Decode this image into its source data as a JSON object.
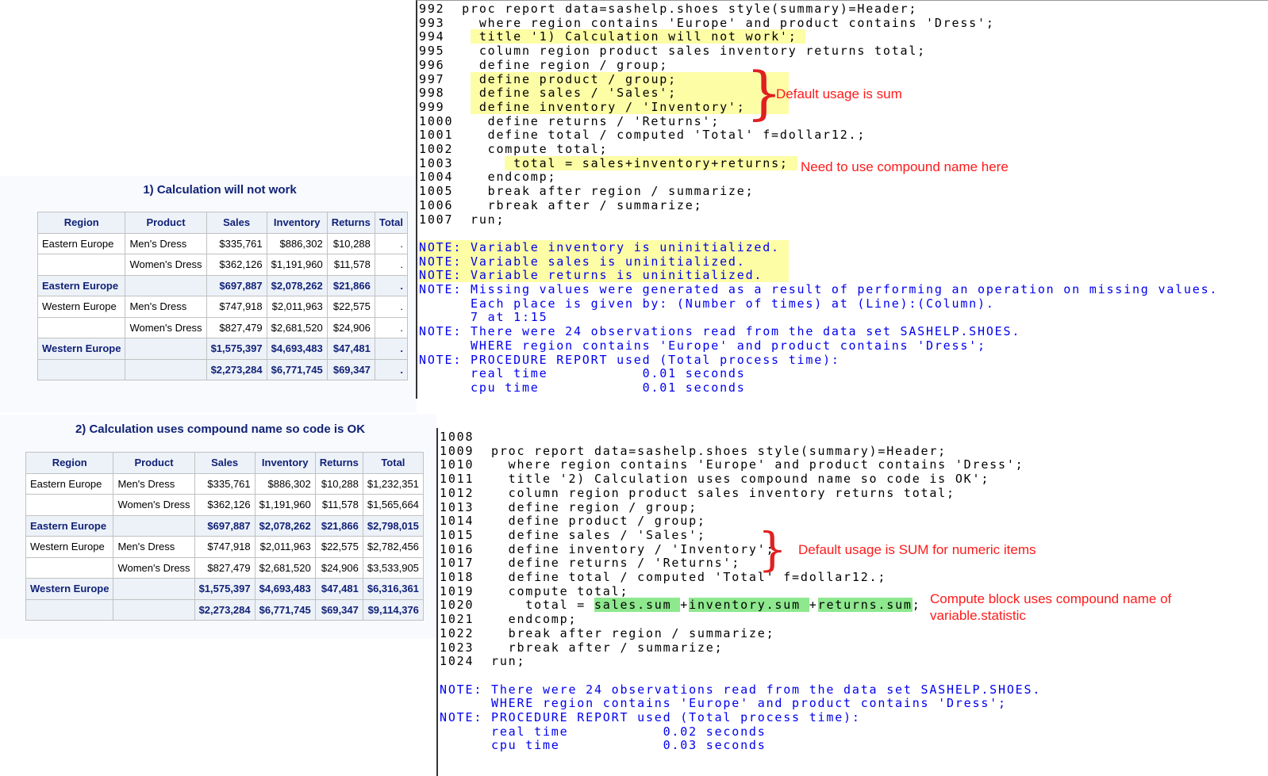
{
  "report1": {
    "title": "1) Calculation will not work",
    "headers": [
      "Region",
      "Product",
      "Sales",
      "Inventory",
      "Returns",
      "Total"
    ],
    "rows": [
      {
        "sum": false,
        "cells": [
          "Eastern Europe",
          "Men's Dress",
          "$335,761",
          "$886,302",
          "$10,288",
          "."
        ]
      },
      {
        "sum": false,
        "cells": [
          "",
          "Women's Dress",
          "$362,126",
          "$1,191,960",
          "$11,578",
          "."
        ]
      },
      {
        "sum": true,
        "cells": [
          "Eastern Europe",
          "",
          "$697,887",
          "$2,078,262",
          "$21,866",
          "."
        ]
      },
      {
        "sum": false,
        "cells": [
          "Western Europe",
          "Men's Dress",
          "$747,918",
          "$2,011,963",
          "$22,575",
          "."
        ]
      },
      {
        "sum": false,
        "cells": [
          "",
          "Women's Dress",
          "$827,479",
          "$2,681,520",
          "$24,906",
          "."
        ]
      },
      {
        "sum": true,
        "cells": [
          "Western Europe",
          "",
          "$1,575,397",
          "$4,693,483",
          "$47,481",
          "."
        ]
      },
      {
        "sum": true,
        "cells": [
          "",
          "",
          "$2,273,284",
          "$6,771,745",
          "$69,347",
          "."
        ]
      }
    ]
  },
  "report2": {
    "title": "2) Calculation uses compound name so code is OK",
    "headers": [
      "Region",
      "Product",
      "Sales",
      "Inventory",
      "Returns",
      "Total"
    ],
    "rows": [
      {
        "sum": false,
        "cells": [
          "Eastern Europe",
          "Men's Dress",
          "$335,761",
          "$886,302",
          "$10,288",
          "$1,232,351"
        ]
      },
      {
        "sum": false,
        "cells": [
          "",
          "Women's Dress",
          "$362,126",
          "$1,191,960",
          "$11,578",
          "$1,565,664"
        ]
      },
      {
        "sum": true,
        "cells": [
          "Eastern Europe",
          "",
          "$697,887",
          "$2,078,262",
          "$21,866",
          "$2,798,015"
        ]
      },
      {
        "sum": false,
        "cells": [
          "Western Europe",
          "Men's Dress",
          "$747,918",
          "$2,011,963",
          "$22,575",
          "$2,782,456"
        ]
      },
      {
        "sum": false,
        "cells": [
          "",
          "Women's Dress",
          "$827,479",
          "$2,681,520",
          "$24,906",
          "$3,533,905"
        ]
      },
      {
        "sum": true,
        "cells": [
          "Western Europe",
          "",
          "$1,575,397",
          "$4,693,483",
          "$47,481",
          "$6,316,361"
        ]
      },
      {
        "sum": true,
        "cells": [
          "",
          "",
          "$2,273,284",
          "$6,771,745",
          "$69,347",
          "$9,114,376"
        ]
      }
    ]
  },
  "log1": [
    [
      {
        "t": "992  proc report data=sashelp.shoes style(summary)=Header;"
      }
    ],
    [
      {
        "t": "993    where region contains 'Europe' and product contains 'Dress';"
      }
    ],
    [
      {
        "t": "994   "
      },
      {
        "t": " title '1) Calculation will not work'; ",
        "hl": "y"
      }
    ],
    [
      {
        "t": "995    column region product sales inventory returns total;"
      }
    ],
    [
      {
        "t": "996    define region / group;"
      }
    ],
    [
      {
        "t": "997   "
      },
      {
        "t": " define product / group;             ",
        "hl": "y"
      }
    ],
    [
      {
        "t": "998   "
      },
      {
        "t": " define sales / 'Sales';             ",
        "hl": "y"
      }
    ],
    [
      {
        "t": "999   "
      },
      {
        "t": " define inventory / 'Inventory';     ",
        "hl": "y"
      }
    ],
    [
      {
        "t": "1000    define returns / 'Returns';"
      }
    ],
    [
      {
        "t": "1001    define total / computed 'Total' f=dollar12.;"
      }
    ],
    [
      {
        "t": "1002    compute total;"
      }
    ],
    [
      {
        "t": "1003      "
      },
      {
        "t": " total = sales+inventory+returns; ",
        "hl": "y"
      }
    ],
    [
      {
        "t": "1004    endcomp;"
      }
    ],
    [
      {
        "t": "1005    break after region / summarize;"
      }
    ],
    [
      {
        "t": "1006    rbreak after / summarize;"
      }
    ],
    [
      {
        "t": "1007  run;"
      }
    ],
    [
      {
        "t": ""
      }
    ],
    [
      {
        "t": "NOTE: Variable inventory is uninitialized. ",
        "hl": "y",
        "note": true
      }
    ],
    [
      {
        "t": "NOTE: Variable sales is uninitialized.     ",
        "hl": "y",
        "note": true
      }
    ],
    [
      {
        "t": "NOTE: Variable returns is uninitialized.   ",
        "hl": "y",
        "note": true
      }
    ],
    [
      {
        "t": "NOTE: Missing values were generated as a result of performing an operation on missing values.",
        "note": true
      }
    ],
    [
      {
        "t": "      Each place is given by: (Number of times) at (Line):(Column).",
        "note": true
      }
    ],
    [
      {
        "t": "      7 at 1:15",
        "note": true
      }
    ],
    [
      {
        "t": "NOTE: There were 24 observations read from the data set SASHELP.SHOES.",
        "note": true
      }
    ],
    [
      {
        "t": "      WHERE region contains 'Europe' and product contains 'Dress';",
        "note": true
      }
    ],
    [
      {
        "t": "NOTE: PROCEDURE REPORT used (Total process time):",
        "note": true
      }
    ],
    [
      {
        "t": "      real time           0.01 seconds",
        "note": true
      }
    ],
    [
      {
        "t": "      cpu time            0.01 seconds",
        "note": true
      }
    ]
  ],
  "log2": [
    [
      {
        "t": "1008"
      }
    ],
    [
      {
        "t": "1009  proc report data=sashelp.shoes style(summary)=Header;"
      }
    ],
    [
      {
        "t": "1010    where region contains 'Europe' and product contains 'Dress';"
      }
    ],
    [
      {
        "t": "1011    title '2) Calculation uses compound name so code is OK';"
      }
    ],
    [
      {
        "t": "1012    column region product sales inventory returns total;"
      }
    ],
    [
      {
        "t": "1013    define region / group;"
      }
    ],
    [
      {
        "t": "1014    define product / group;"
      }
    ],
    [
      {
        "t": "1015    define sales / 'Sales';"
      }
    ],
    [
      {
        "t": "1016    define inventory / 'Inventory';"
      }
    ],
    [
      {
        "t": "1017    define returns / 'Returns';"
      }
    ],
    [
      {
        "t": "1018    define total / computed 'Total' f=dollar12.;"
      }
    ],
    [
      {
        "t": "1019    compute total;"
      }
    ],
    [
      {
        "t": "1020      total = "
      },
      {
        "t": "sales.sum ",
        "hl": "g"
      },
      {
        "t": "+"
      },
      {
        "t": "inventory.sum ",
        "hl": "g"
      },
      {
        "t": "+"
      },
      {
        "t": "returns.sum",
        "hl": "g"
      },
      {
        "t": ";"
      }
    ],
    [
      {
        "t": "1021    endcomp;"
      }
    ],
    [
      {
        "t": "1022    break after region / summarize;"
      }
    ],
    [
      {
        "t": "1023    rbreak after / summarize;"
      }
    ],
    [
      {
        "t": "1024  run;"
      }
    ],
    [
      {
        "t": ""
      }
    ],
    [
      {
        "t": "NOTE: There were 24 observations read from the data set SASHELP.SHOES.",
        "note": true
      }
    ],
    [
      {
        "t": "      WHERE region contains 'Europe' and product contains 'Dress';",
        "note": true
      }
    ],
    [
      {
        "t": "NOTE: PROCEDURE REPORT used (Total process time):",
        "note": true
      }
    ],
    [
      {
        "t": "      real time           0.02 seconds",
        "note": true
      }
    ],
    [
      {
        "t": "      cpu time            0.03 seconds",
        "note": true
      }
    ]
  ],
  "annotations": {
    "a1": "Default usage is sum",
    "a2": "Need to use compound name here",
    "a3": "Default usage is SUM for numeric items",
    "a4_line1": "Compute block uses compound name of",
    "a4_line2": "variable.statistic"
  },
  "colors": {
    "highlight_yellow": "#fdfda6",
    "highlight_green": "#8ee88e",
    "note_blue": "#0000ee",
    "annotation_red": "#ff1a1a",
    "header_navy": "#112277"
  }
}
